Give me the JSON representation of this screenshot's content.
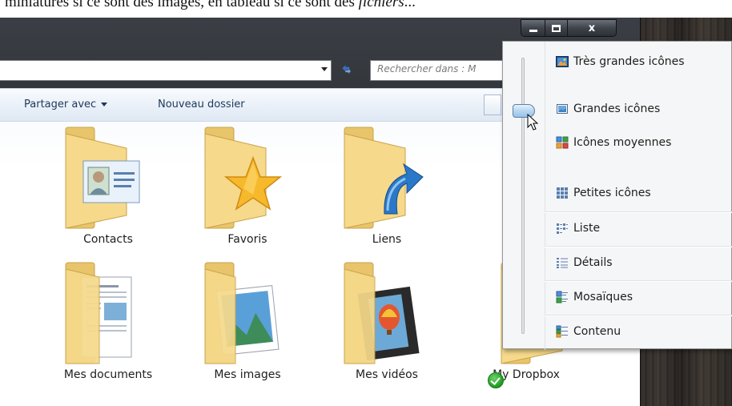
{
  "caption_text": "miniatures si ce sont des images, en tableau si ce sont des ",
  "caption_italic": "fichiers",
  "caption_tail": "...",
  "window": {
    "caption_buttons": {
      "minimize": "",
      "maximize": "",
      "close": "x"
    }
  },
  "address": {
    "search_placeholder": "Rechercher dans : M",
    "refresh_icon": "refresh-icon"
  },
  "toolbar": {
    "share_label": "Partager avec",
    "new_folder_label": "Nouveau dossier"
  },
  "folders": [
    {
      "name": "Contacts",
      "overlay": "contact-card"
    },
    {
      "name": "Favoris",
      "overlay": "star"
    },
    {
      "name": "Liens",
      "overlay": "arrow"
    },
    {
      "name": "Mes documents",
      "overlay": "document"
    },
    {
      "name": "Mes images",
      "overlay": "landscape"
    },
    {
      "name": "Mes vidéos",
      "overlay": "film"
    },
    {
      "name": "My Dropbox",
      "overlay": "dropbox-check"
    }
  ],
  "view_menu": {
    "items": [
      {
        "label": "Très grandes icônes",
        "icon": "extra-large-icons-icon"
      },
      {
        "label": "Grandes icônes",
        "icon": "large-icons-icon"
      },
      {
        "label": "Icônes moyennes",
        "icon": "medium-icons-icon"
      },
      {
        "label": "Petites icônes",
        "icon": "small-icons-icon"
      },
      {
        "label": "Liste",
        "icon": "list-icon"
      },
      {
        "label": "Détails",
        "icon": "details-icon"
      },
      {
        "label": "Mosaïques",
        "icon": "tiles-icon"
      },
      {
        "label": "Contenu",
        "icon": "content-icon"
      }
    ],
    "selected": "Grandes icônes"
  },
  "colors": {
    "folder": "#f1cd74",
    "toolbar_text": "#1e395b",
    "accent": "#3a6fc0"
  }
}
